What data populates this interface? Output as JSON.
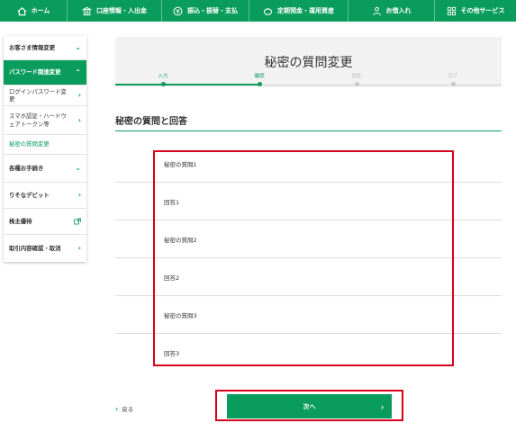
{
  "topnav": {
    "items": [
      {
        "label": "ホーム",
        "icon": "house-icon"
      },
      {
        "label": "口座情報・入出金",
        "icon": "building-icon"
      },
      {
        "label": "振込・振替・支払",
        "icon": "yen-coin-icon"
      },
      {
        "label": "定期預金・運用資産",
        "icon": "piggy-bank-icon"
      },
      {
        "label": "お借入れ",
        "icon": "person-money-icon"
      },
      {
        "label": "その他サービス",
        "icon": "grid-icon"
      }
    ]
  },
  "sidebar": {
    "items": [
      {
        "label": "お客さま情報変更"
      },
      {
        "label": "パスワード関連変更"
      },
      {
        "label": "ログインパスワード変更"
      },
      {
        "label": "スマホ認証・ハードウェアトークン等"
      },
      {
        "label": "秘密の質問変更"
      },
      {
        "label": "各種お手続き"
      },
      {
        "label": "りそなデビット"
      },
      {
        "label": "株主優待"
      },
      {
        "label": "取引内容確認・取消"
      }
    ]
  },
  "page": {
    "title": "秘密の質問変更",
    "steps": [
      "入力",
      "確認",
      "認証",
      "完了"
    ],
    "section_title": "秘密の質問と回答",
    "rows": [
      "秘密の質問1",
      "回答1",
      "秘密の質問2",
      "回答2",
      "秘密の質問3",
      "回答3"
    ]
  },
  "footer": {
    "back_label": "戻る",
    "next_label": "次へ"
  },
  "colors": {
    "brand_green": "#0a9c5c",
    "highlight_red": "#d9001b"
  }
}
